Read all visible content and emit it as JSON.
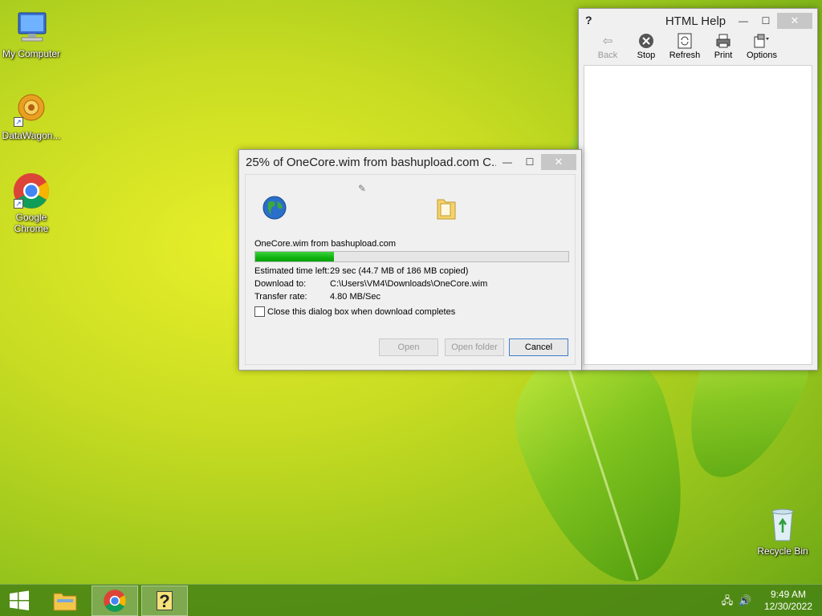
{
  "desktop": {
    "icons": [
      {
        "label": "My Computer",
        "icon": "computer-icon"
      },
      {
        "label": "DataWagon...",
        "icon": "datawagon-icon"
      },
      {
        "label": "Google Chrome",
        "icon": "chrome-icon"
      },
      {
        "label": "Recycle Bin",
        "icon": "recycle-bin-icon"
      }
    ]
  },
  "download_dialog": {
    "title": "25% of OneCore.wim from bashupload.com C...",
    "minimize_glyph": "—",
    "maximize_glyph": "☐",
    "close_glyph": "✕",
    "file_label": "OneCore.wim from bashupload.com",
    "progress": 0.25,
    "estimated_time_label": "Estimated time left:",
    "estimated_time_value": "29 sec (44.7 MB of 186 MB copied)",
    "download_to_label": "Download to:",
    "download_to_value": "C:\\Users\\VM4\\Downloads\\OneCore.wim",
    "transfer_rate_label": "Transfer rate:",
    "transfer_rate_value": "4.80 MB/Sec",
    "close_when_done_label": "Close this dialog box when download completes",
    "close_when_done_checked": false,
    "open_label": "Open",
    "open_folder_label": "Open folder",
    "cancel_label": "Cancel"
  },
  "html_help": {
    "title": "HTML Help",
    "minimize_glyph": "—",
    "maximize_glyph": "☐",
    "close_glyph": "✕",
    "toolbar": [
      {
        "label": "Back",
        "icon": "back-arrow-icon",
        "enabled": false
      },
      {
        "label": "Stop",
        "icon": "stop-icon",
        "enabled": true
      },
      {
        "label": "Refresh",
        "icon": "refresh-icon",
        "enabled": true
      },
      {
        "label": "Print",
        "icon": "print-icon",
        "enabled": true
      },
      {
        "label": "Options",
        "icon": "options-icon",
        "enabled": true
      }
    ]
  },
  "taskbar": {
    "items": [
      "start-button",
      "file-explorer",
      "chrome",
      "html-help"
    ],
    "time": "9:49 AM",
    "date": "12/30/2022"
  },
  "colors": {
    "progress_fill": "#0fb20f",
    "accent_button_border": "#3c7fd0",
    "taskbar": "#46821a"
  }
}
